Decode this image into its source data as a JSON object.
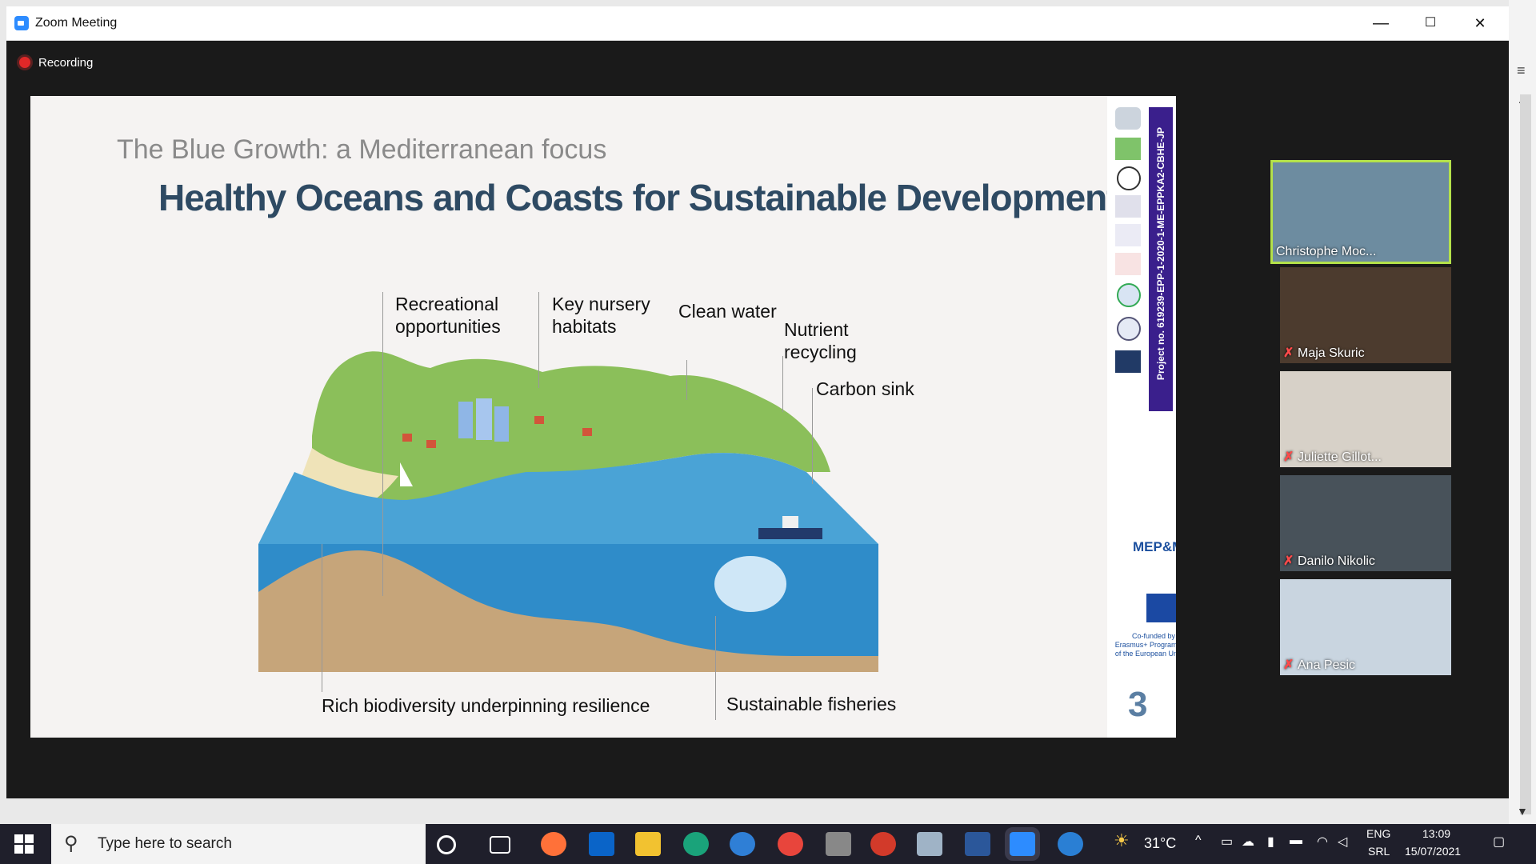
{
  "window": {
    "title": "Zoom Meeting",
    "minimize": "—",
    "maximize": "☐",
    "close": "✕"
  },
  "recording": {
    "label": "Recording"
  },
  "slide": {
    "subtitle": "The Blue Growth: a Mediterranean focus",
    "title": "Healthy Oceans and Coasts for Sustainable Development",
    "labels": {
      "recreational": "Recreational opportunities",
      "nursery": "Key nursery habitats",
      "clean_water": "Clean water",
      "nutrient": "Nutrient recycling",
      "carbon": "Carbon sink",
      "biodiversity": "Rich biodiversity underpinning resilience",
      "fisheries": "Sustainable fisheries"
    },
    "project_no": "Project no. 619239-EPP-1-2020-1-ME-EPPKA2-CBHE-JP",
    "mepm": "MEP&M",
    "eu_text": "Co-funded by the Erasmus+ Programme of the European Union",
    "page_number": "3"
  },
  "participants": [
    {
      "name": "Christophe Moc...",
      "muted": false,
      "active": true
    },
    {
      "name": "Maja Skuric",
      "muted": true,
      "active": false
    },
    {
      "name": "Juliette Gillot...",
      "muted": true,
      "active": false
    },
    {
      "name": "Danilo Nikolic",
      "muted": true,
      "active": false
    },
    {
      "name": "Ana Pesic",
      "muted": true,
      "active": false
    }
  ],
  "taskbar": {
    "search_placeholder": "Type here to search",
    "weather": "31°C",
    "lang1": "ENG",
    "lang2": "SRL",
    "time": "13:09",
    "date": "15/07/2021"
  },
  "colors": {
    "zoom_blue": "#2d8cff",
    "slide_title": "#2e4a63",
    "active_speaker": "#b4e14a"
  }
}
